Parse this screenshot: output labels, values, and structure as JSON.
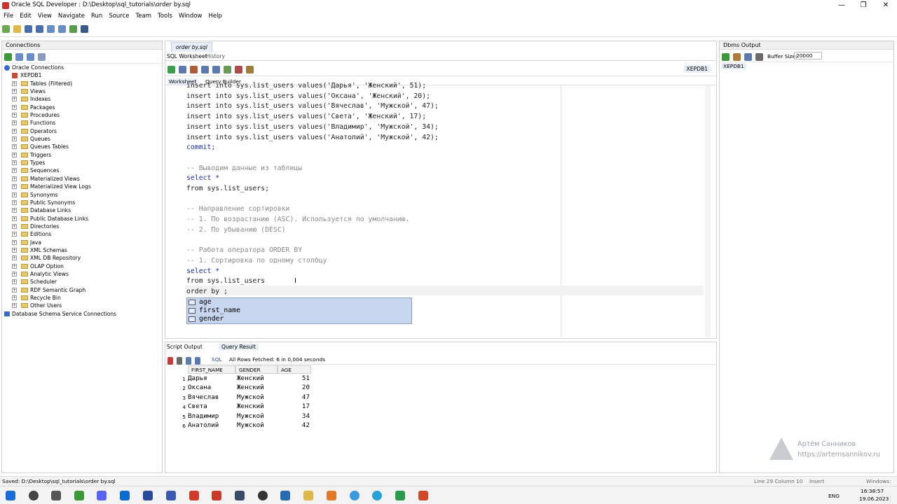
{
  "window": {
    "title": "Oracle SQL Developer : D:\\Desktop\\sql_tutorials\\order by.sql",
    "minimize": "—",
    "restore": "❐",
    "close": "✕"
  },
  "menu": [
    "File",
    "Edit",
    "View",
    "Navigate",
    "Run",
    "Source",
    "Team",
    "Tools",
    "Window",
    "Help"
  ],
  "connections": {
    "title": "Connections",
    "root": "Oracle Connections",
    "db": "XEPDB1",
    "items": [
      "Tables (Filtered)",
      "Views",
      "Indexes",
      "Packages",
      "Procedures",
      "Functions",
      "Operators",
      "Queues",
      "Queues Tables",
      "Triggers",
      "Types",
      "Sequences",
      "Materialized Views",
      "Materialized View Logs",
      "Synonyms",
      "Public Synonyms",
      "Database Links",
      "Public Database Links",
      "Directories",
      "Editions",
      "Java",
      "XML Schemas",
      "XML DB Repository",
      "OLAP Option",
      "Analytic Views",
      "Scheduler",
      "RDF Semantic Graph",
      "Recycle Bin",
      "Other Users"
    ],
    "footer": "Database Schema Service Connections"
  },
  "editor": {
    "file_tab": "order by.sql",
    "tabs": [
      "SQL Worksheet",
      "History"
    ],
    "subtabs": [
      "Worksheet",
      "Query Builder"
    ],
    "connection": "XEPDB1",
    "lines": [
      {
        "t": "insert into sys.list_users values('Дарья', 'Женский', 51);",
        "c": "pl"
      },
      {
        "t": "insert into sys.list_users values('Оксана', 'Женский', 20);",
        "c": "pl"
      },
      {
        "t": "insert into sys.list_users values('Вячеслав', 'Мужской', 47);",
        "c": "pl"
      },
      {
        "t": "insert into sys.list_users values('Света', 'Женский', 17);",
        "c": "pl"
      },
      {
        "t": "insert into sys.list_users values('Владимир', 'Мужской', 34);",
        "c": "pl"
      },
      {
        "t": "insert into sys.list_users values('Анатолий', 'Мужской', 42);",
        "c": "pl"
      },
      {
        "t": "commit;",
        "c": "kw"
      },
      {
        "t": "",
        "c": "pl"
      },
      {
        "t": "-- Выводим данные из таблицы",
        "c": "cm"
      },
      {
        "t": "select *",
        "c": "kw"
      },
      {
        "t": "from sys.list_users;",
        "c": "pl"
      },
      {
        "t": "",
        "c": "pl"
      },
      {
        "t": "-- Направление сортировки",
        "c": "cm"
      },
      {
        "t": "-- 1. По возрастанию (ASC). Используется по умолчанию.",
        "c": "cm"
      },
      {
        "t": "-- 2. По убыванию (DESC)",
        "c": "cm"
      },
      {
        "t": "",
        "c": "pl"
      },
      {
        "t": "-- Работа оператора ORDER BY",
        "c": "cm"
      },
      {
        "t": "-- 1. Сортировка по одному столбцу",
        "c": "cm"
      },
      {
        "t": "select *",
        "c": "kw"
      },
      {
        "t": "from sys.list_users",
        "c": "pl"
      },
      {
        "t": "order by ;",
        "c": "pl"
      }
    ],
    "autocomplete": [
      "age",
      "first_name",
      "gender"
    ]
  },
  "results": {
    "tabs": [
      "Script Output",
      "Query Result"
    ],
    "sql_label": "SQL",
    "fetch_status": "All Rows Fetched: 6 in 0,004 seconds",
    "columns": [
      "FIRST_NAME",
      "GENDER",
      "AGE"
    ],
    "rows": [
      [
        "1",
        "Дарья",
        "Женский",
        "51"
      ],
      [
        "2",
        "Оксана",
        "Женский",
        "20"
      ],
      [
        "3",
        "Вячеслав",
        "Мужской",
        "47"
      ],
      [
        "4",
        "Света",
        "Женский",
        "17"
      ],
      [
        "5",
        "Владимир",
        "Мужской",
        "34"
      ],
      [
        "6",
        "Анатолий",
        "Мужской",
        "42"
      ]
    ]
  },
  "dbms": {
    "title": "Dbms Output",
    "buffer_label": "Buffer Size:",
    "buffer_value": "20000",
    "tab": "XEPDB1"
  },
  "status": {
    "saved": "Saved: D:\\Desktop\\sql_tutorials\\order by.sql",
    "position": "Line 29 Column 10",
    "mode": "Insert",
    "platform": "Windows: CI"
  },
  "taskbar": {
    "lang": "ENG",
    "time": "16:38:57",
    "date": "19.06.2023"
  },
  "watermark": {
    "name": "Артём Санников",
    "url": "https://artemsannikov.ru"
  }
}
